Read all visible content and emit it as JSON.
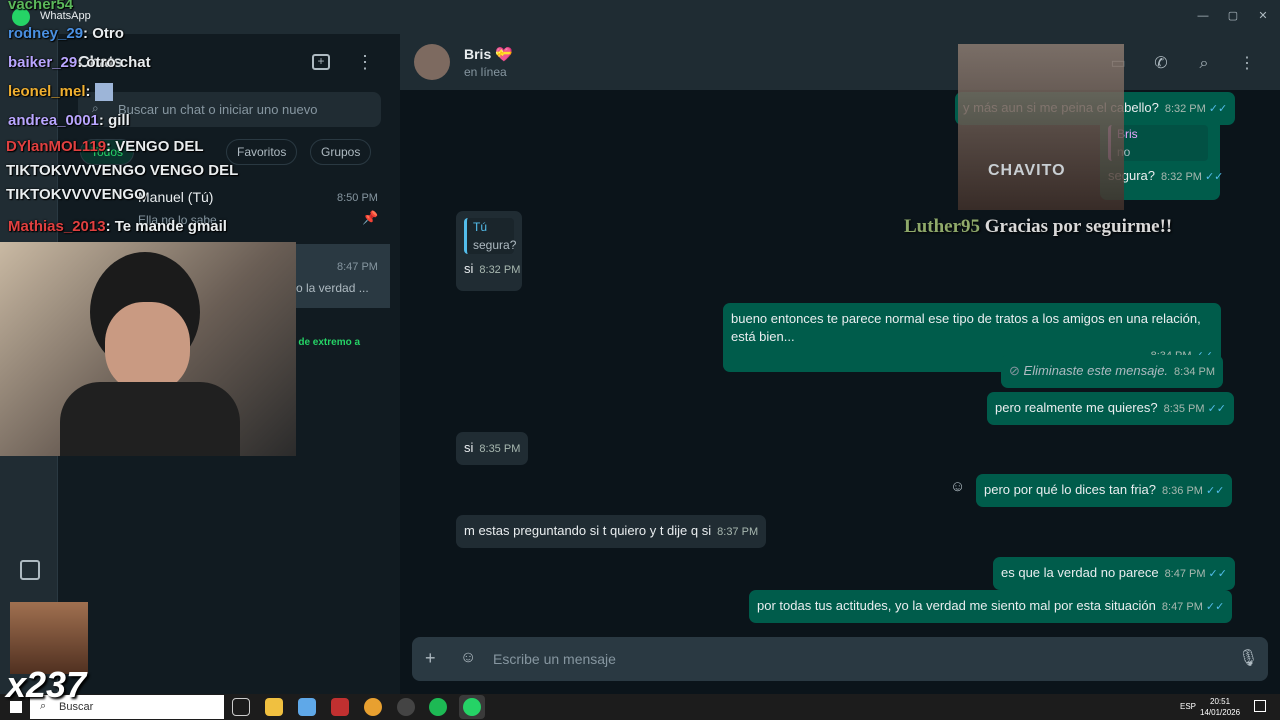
{
  "window": {
    "app_title": "WhatsApp"
  },
  "overlay_chat": [
    {
      "user": "vacher54",
      "color": "#5bb85b",
      "text": ""
    },
    {
      "user": "rodney_29",
      "color": "#4a90e2",
      "text": ": Otro"
    },
    {
      "user": "baiker_29",
      "color": "#b9a6ff",
      "text": ": otro chat"
    },
    {
      "user": "leonel_mel",
      "color": "#f0b030",
      "text": ":"
    },
    {
      "user": "andrea_0001",
      "color": "#b9a6ff",
      "text": ": gill"
    },
    {
      "user": "DYlanMOL119",
      "color": "#e04040",
      "text": ": VENGO DEL TIKTOKVVVVENGO VENGO DEL TIKTOKVVVVENGO"
    },
    {
      "user": "Mathias_2013",
      "color": "#e04040",
      "text": ": Te mande gmail"
    }
  ],
  "counter": "x237",
  "chatlist": {
    "title": "Chats",
    "search_placeholder": "Buscar un chat o iniciar uno nuevo",
    "filters": [
      "Todos",
      "Favoritos",
      "Grupos"
    ],
    "items": [
      {
        "name": "Manuel (Tú)",
        "time": "8:50 PM",
        "preview": "Ella no lo sabe"
      },
      {
        "name": "",
        "time": "8:47 PM",
        "preview": "o la verdad ..."
      }
    ],
    "archived_text": "s de extremo a"
  },
  "conversation": {
    "contact_name": "Bris",
    "contact_emoji": "💝",
    "status": "en línea",
    "messages": [
      {
        "dir": "out",
        "text": "y más aun si me peina el cabello?",
        "time": "8:32 PM"
      },
      {
        "dir": "out",
        "quote_author": "Bris",
        "quote_text": "no",
        "text": "segura?",
        "time": "8:32 PM"
      },
      {
        "dir": "in",
        "quote_author": "Tú",
        "quote_text": "segura?",
        "text": "si",
        "time": "8:32 PM"
      },
      {
        "dir": "out",
        "text": "bueno entonces te parece normal ese tipo de tratos a los amigos en una relación, está bien...",
        "time": "8:34 PM"
      },
      {
        "dir": "out",
        "text": "Eliminaste este mensaje.",
        "time": "8:34 PM"
      },
      {
        "dir": "out",
        "text": "pero realmente me quieres?",
        "time": "8:35 PM"
      },
      {
        "dir": "in",
        "text": "si",
        "time": "8:35 PM"
      },
      {
        "dir": "out",
        "text": "pero por qué lo dices tan fria?",
        "time": "8:36 PM"
      },
      {
        "dir": "in",
        "text": "m estas preguntando si t quiero y t dije q si",
        "time": "8:37 PM"
      },
      {
        "dir": "out",
        "text": "es que la verdad no parece",
        "time": "8:47 PM"
      },
      {
        "dir": "out",
        "text": "por todas tus actitudes, yo la verdad me siento mal por esta situación",
        "time": "8:47 PM"
      }
    ],
    "composer_placeholder": "Escribe un mensaje"
  },
  "stream": {
    "cam_label": "CHAVITO",
    "follow_name": "Luther95",
    "follow_text": "Gracias por seguirme!!"
  },
  "taskbar": {
    "search": "Buscar",
    "lang": "ESP",
    "time": "20:51",
    "date": "14/01/2026"
  },
  "colors": {
    "accent": "#25d366",
    "outgoing_bubble": "#005c4b",
    "incoming_bubble": "#202c33",
    "read_ticks": "#53bdeb"
  }
}
